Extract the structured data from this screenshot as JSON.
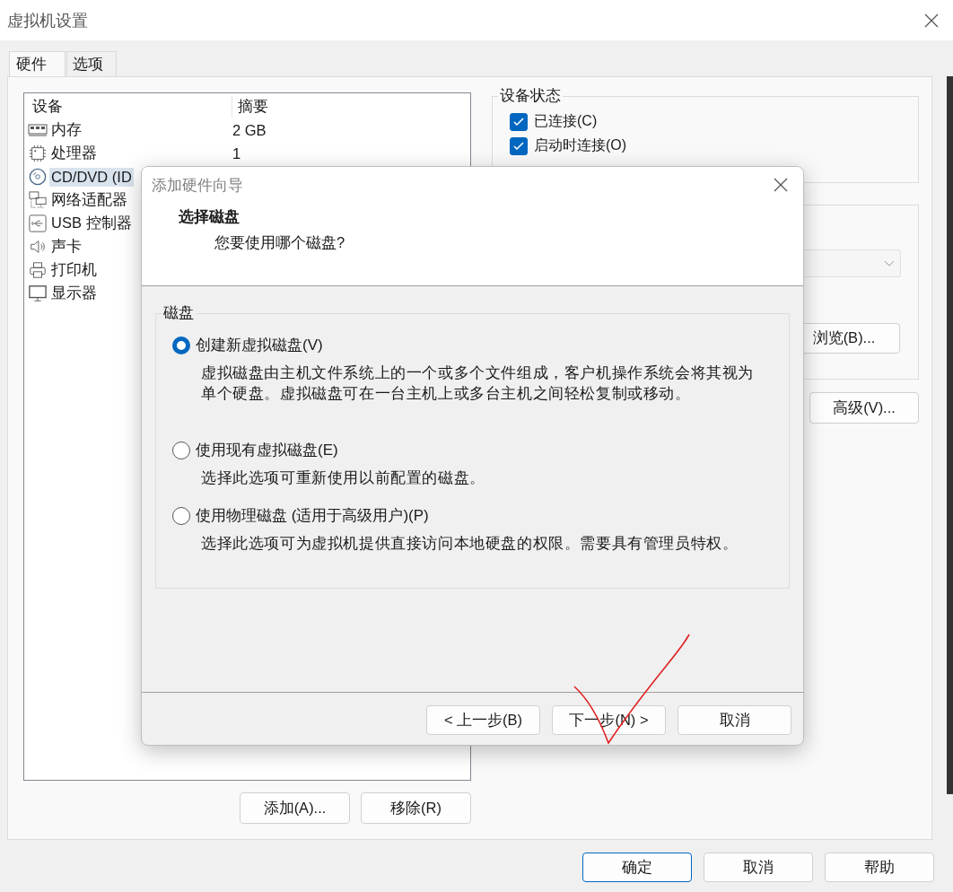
{
  "window": {
    "title": "虚拟机设置"
  },
  "tabs": [
    {
      "label": "硬件",
      "selected": true
    },
    {
      "label": "选项",
      "selected": false
    }
  ],
  "device_list": {
    "columns": [
      "设备",
      "摘要"
    ],
    "rows": [
      {
        "kind": "memory",
        "device": "内存",
        "summary": "2 GB",
        "selected": false
      },
      {
        "kind": "processor",
        "device": "处理器",
        "summary": "1",
        "selected": false
      },
      {
        "kind": "disc",
        "device": "CD/DVD (ID",
        "selected": true
      },
      {
        "kind": "network",
        "device": "网络适配器",
        "selected": false
      },
      {
        "kind": "usb",
        "device": "USB 控制器",
        "selected": false
      },
      {
        "kind": "sound",
        "device": "声卡",
        "selected": false
      },
      {
        "kind": "printer",
        "device": "打印机",
        "selected": false
      },
      {
        "kind": "display",
        "device": "显示器",
        "selected": false
      }
    ]
  },
  "device_buttons": [
    "添加(A)...",
    "移除(R)"
  ],
  "device_status": {
    "title": "设备状态",
    "options": [
      {
        "label": "已连接(C)",
        "checked": true
      },
      {
        "label": "启动时连接(O)",
        "checked": true
      }
    ]
  },
  "connection_buttons": [
    "浏览(B)...",
    "高级(V)..."
  ],
  "dialog_buttons": [
    {
      "label": "确定",
      "default": true
    },
    {
      "label": "取消",
      "default": false
    },
    {
      "label": "帮助",
      "default": false
    }
  ],
  "wizard": {
    "title": "添加硬件向导",
    "heading": "选择磁盘",
    "subheading": "您要使用哪个磁盘?",
    "group_title": "磁盘",
    "options": [
      {
        "label": "创建新虚拟磁盘(V)",
        "description": "虚拟磁盘由主机文件系统上的一个或多个文件组成，客户机操作系统会将其视为单个硬盘。虚拟磁盘可在一台主机上或多台主机之间轻松复制或移动。",
        "selected": true
      },
      {
        "label": "使用现有虚拟磁盘(E)",
        "description": "选择此选项可重新使用以前配置的磁盘。",
        "selected": false
      },
      {
        "label": "使用物理磁盘 (适用于高级用户)(P)",
        "description": "选择此选项可为虚拟机提供直接访问本地硬盘的权限。需要具有管理员特权。",
        "selected": false
      }
    ],
    "buttons": [
      "< 上一步(B)",
      "下一步(N) >",
      "取消"
    ]
  }
}
